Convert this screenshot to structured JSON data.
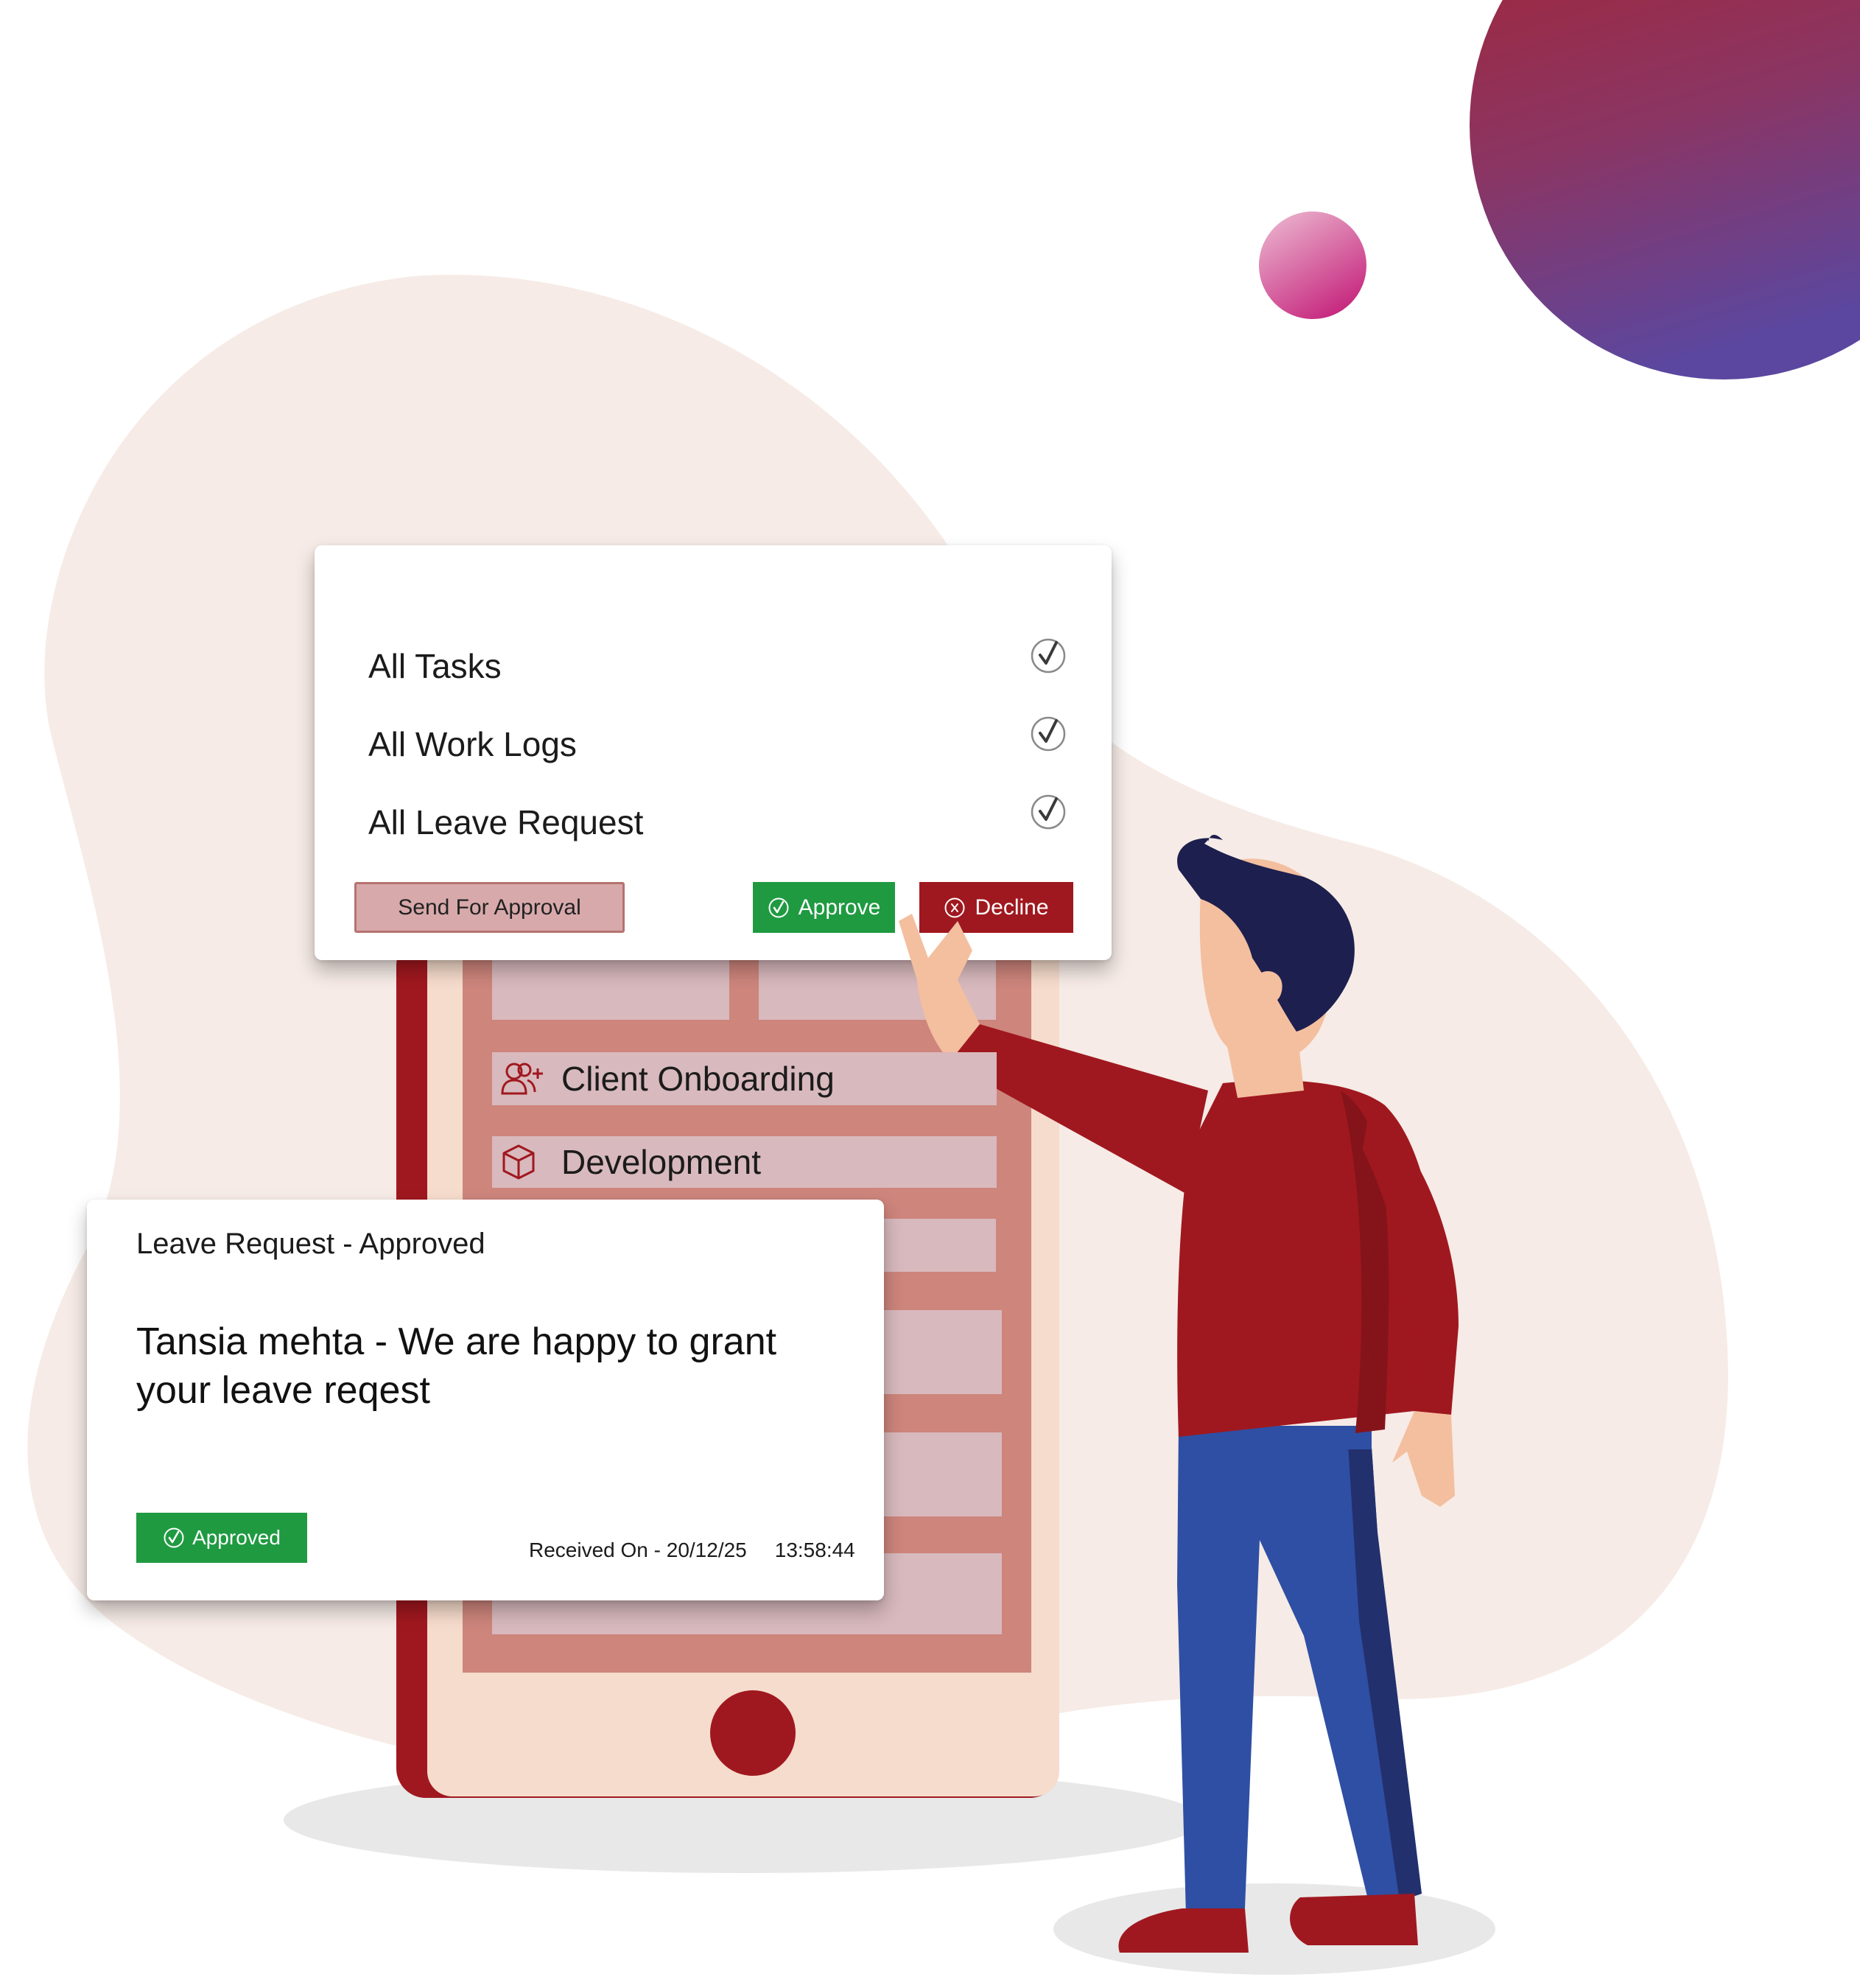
{
  "colors": {
    "brand_red": "#a0181f",
    "phone_screen": "#cd857c",
    "row_fill": "#d8b9bd",
    "approve_green": "#1f9a41",
    "blob": "#f6ebe6"
  },
  "approval_card": {
    "items": [
      {
        "label": "All Tasks",
        "icon": "check-circle-icon"
      },
      {
        "label": "All Work Logs",
        "icon": "check-circle-icon"
      },
      {
        "label": "All Leave Request",
        "icon": "check-circle-icon"
      }
    ],
    "send_label": "Send For Approval",
    "approve_label": "Approve",
    "decline_label": "Decline"
  },
  "phone": {
    "rows": [
      {
        "label": "Client Onboarding",
        "icon": "user-plus-icon"
      },
      {
        "label": "Development",
        "icon": "cube-icon"
      }
    ]
  },
  "notification": {
    "title": "Leave Request - Approved",
    "message": "Tansia mehta - We are happy to grant your leave reqest",
    "badge": "Approved",
    "received_label": "Received On - 20/12/25",
    "time": "13:58:44"
  }
}
